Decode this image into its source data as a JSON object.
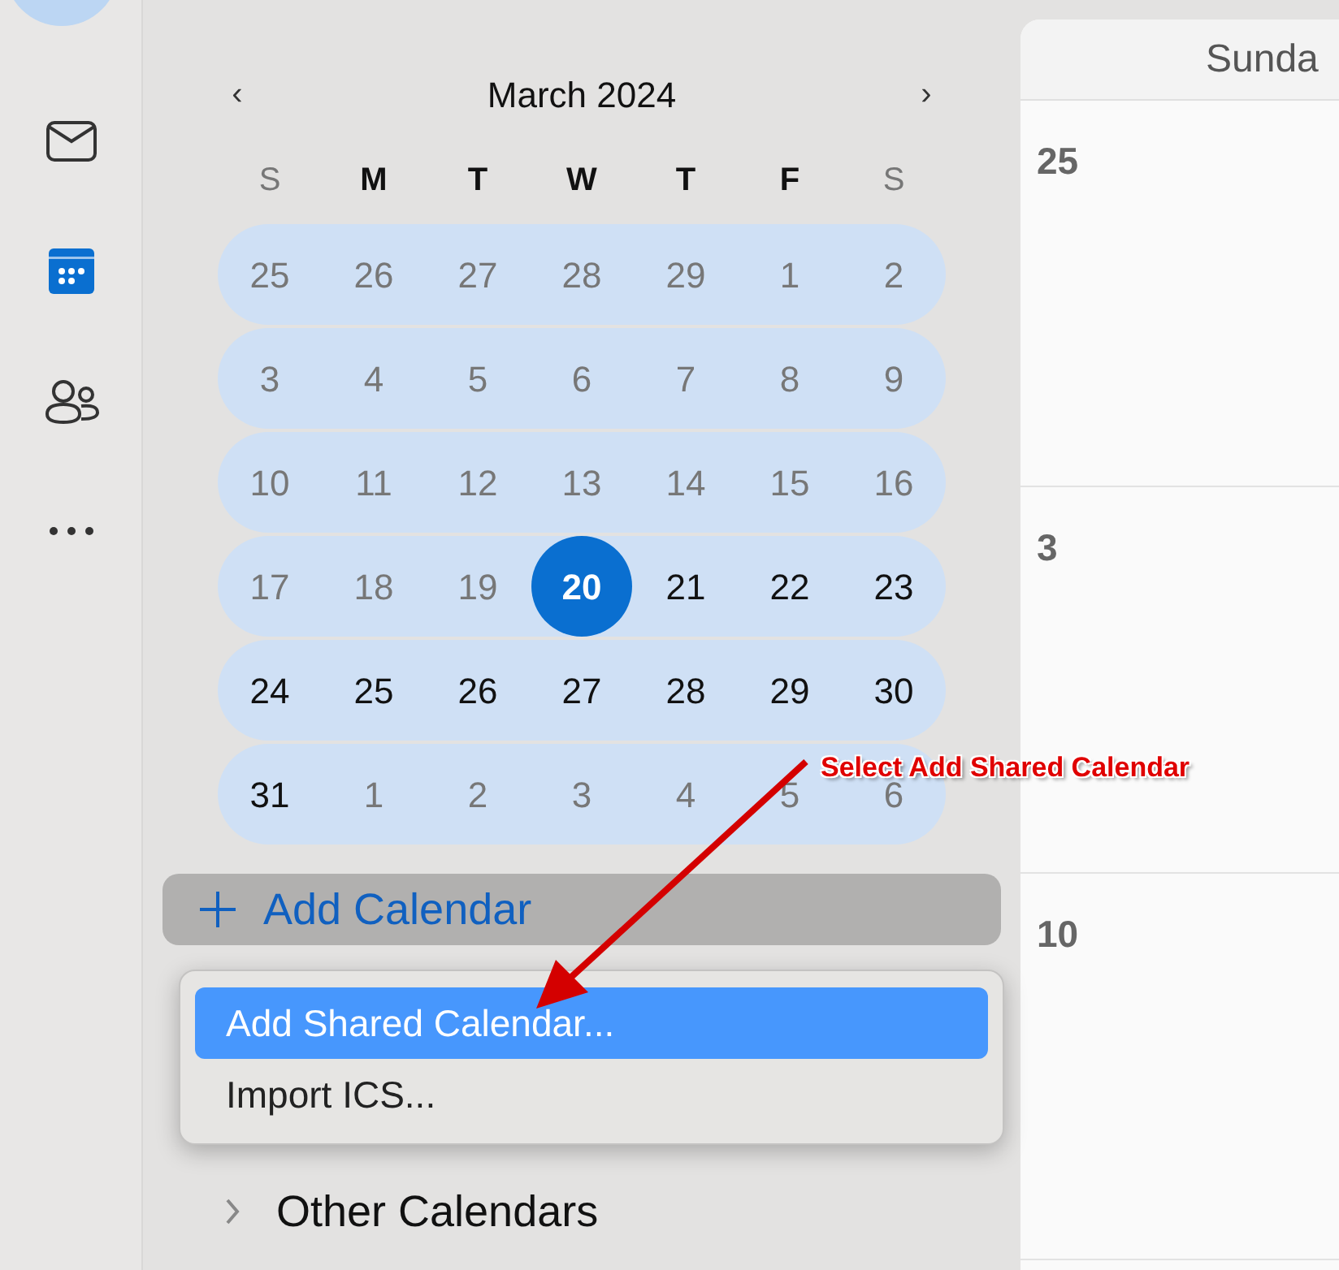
{
  "rail": {
    "items": [
      {
        "kind": "mail",
        "selected": false
      },
      {
        "kind": "calendar",
        "selected": true
      },
      {
        "kind": "people",
        "selected": false
      },
      {
        "kind": "more",
        "selected": false
      }
    ]
  },
  "mini_calendar": {
    "prev": "‹",
    "title": "March 2024",
    "next": "›",
    "weekdays": [
      {
        "label": "S",
        "muted": true
      },
      {
        "label": "M",
        "muted": false
      },
      {
        "label": "T",
        "muted": false
      },
      {
        "label": "W",
        "muted": false
      },
      {
        "label": "T",
        "muted": false
      },
      {
        "label": "F",
        "muted": false
      },
      {
        "label": "S",
        "muted": true
      }
    ],
    "weeks": [
      [
        {
          "day": "25",
          "muted": true,
          "selected": false
        },
        {
          "day": "26",
          "muted": true,
          "selected": false
        },
        {
          "day": "27",
          "muted": true,
          "selected": false
        },
        {
          "day": "28",
          "muted": true,
          "selected": false
        },
        {
          "day": "29",
          "muted": true,
          "selected": false
        },
        {
          "day": "1",
          "muted": true,
          "selected": false
        },
        {
          "day": "2",
          "muted": true,
          "selected": false
        }
      ],
      [
        {
          "day": "3",
          "muted": true,
          "selected": false
        },
        {
          "day": "4",
          "muted": true,
          "selected": false
        },
        {
          "day": "5",
          "muted": true,
          "selected": false
        },
        {
          "day": "6",
          "muted": true,
          "selected": false
        },
        {
          "day": "7",
          "muted": true,
          "selected": false
        },
        {
          "day": "8",
          "muted": true,
          "selected": false
        },
        {
          "day": "9",
          "muted": true,
          "selected": false
        }
      ],
      [
        {
          "day": "10",
          "muted": true,
          "selected": false
        },
        {
          "day": "11",
          "muted": true,
          "selected": false
        },
        {
          "day": "12",
          "muted": true,
          "selected": false
        },
        {
          "day": "13",
          "muted": true,
          "selected": false
        },
        {
          "day": "14",
          "muted": true,
          "selected": false
        },
        {
          "day": "15",
          "muted": true,
          "selected": false
        },
        {
          "day": "16",
          "muted": true,
          "selected": false
        }
      ],
      [
        {
          "day": "17",
          "muted": true,
          "selected": false
        },
        {
          "day": "18",
          "muted": true,
          "selected": false
        },
        {
          "day": "19",
          "muted": true,
          "selected": false
        },
        {
          "day": "20",
          "selected": true
        },
        {
          "day": "21",
          "muted": false,
          "selected": false
        },
        {
          "day": "22",
          "muted": false,
          "selected": false
        },
        {
          "day": "23",
          "muted": false,
          "selected": false
        }
      ],
      [
        {
          "day": "24",
          "muted": false,
          "selected": false
        },
        {
          "day": "25",
          "muted": false,
          "selected": false
        },
        {
          "day": "26",
          "muted": false,
          "selected": false
        },
        {
          "day": "27",
          "muted": false,
          "selected": false
        },
        {
          "day": "28",
          "muted": false,
          "selected": false
        },
        {
          "day": "29",
          "muted": false,
          "selected": false
        },
        {
          "day": "30",
          "muted": false,
          "selected": false
        }
      ],
      [
        {
          "day": "31",
          "muted": false,
          "selected": false
        },
        {
          "day": "1",
          "muted": true,
          "selected": false
        },
        {
          "day": "2",
          "muted": true,
          "selected": false
        },
        {
          "day": "3",
          "muted": true,
          "selected": false
        },
        {
          "day": "4",
          "muted": true,
          "selected": false
        },
        {
          "day": "5",
          "muted": true,
          "selected": false
        },
        {
          "day": "6",
          "muted": true,
          "selected": false
        }
      ]
    ]
  },
  "add_calendar": {
    "label": "Add Calendar"
  },
  "menu": {
    "items": [
      {
        "label": "Add Shared Calendar...",
        "selected": true
      },
      {
        "label": "Import ICS...",
        "selected": false
      }
    ]
  },
  "calendar_groups": [
    {
      "label": "Other Calendars"
    }
  ],
  "day_view": {
    "column": "Sunda",
    "dates": [
      "25",
      "3",
      "10"
    ]
  },
  "annotation": {
    "text": "Select Add Shared Calendar"
  }
}
